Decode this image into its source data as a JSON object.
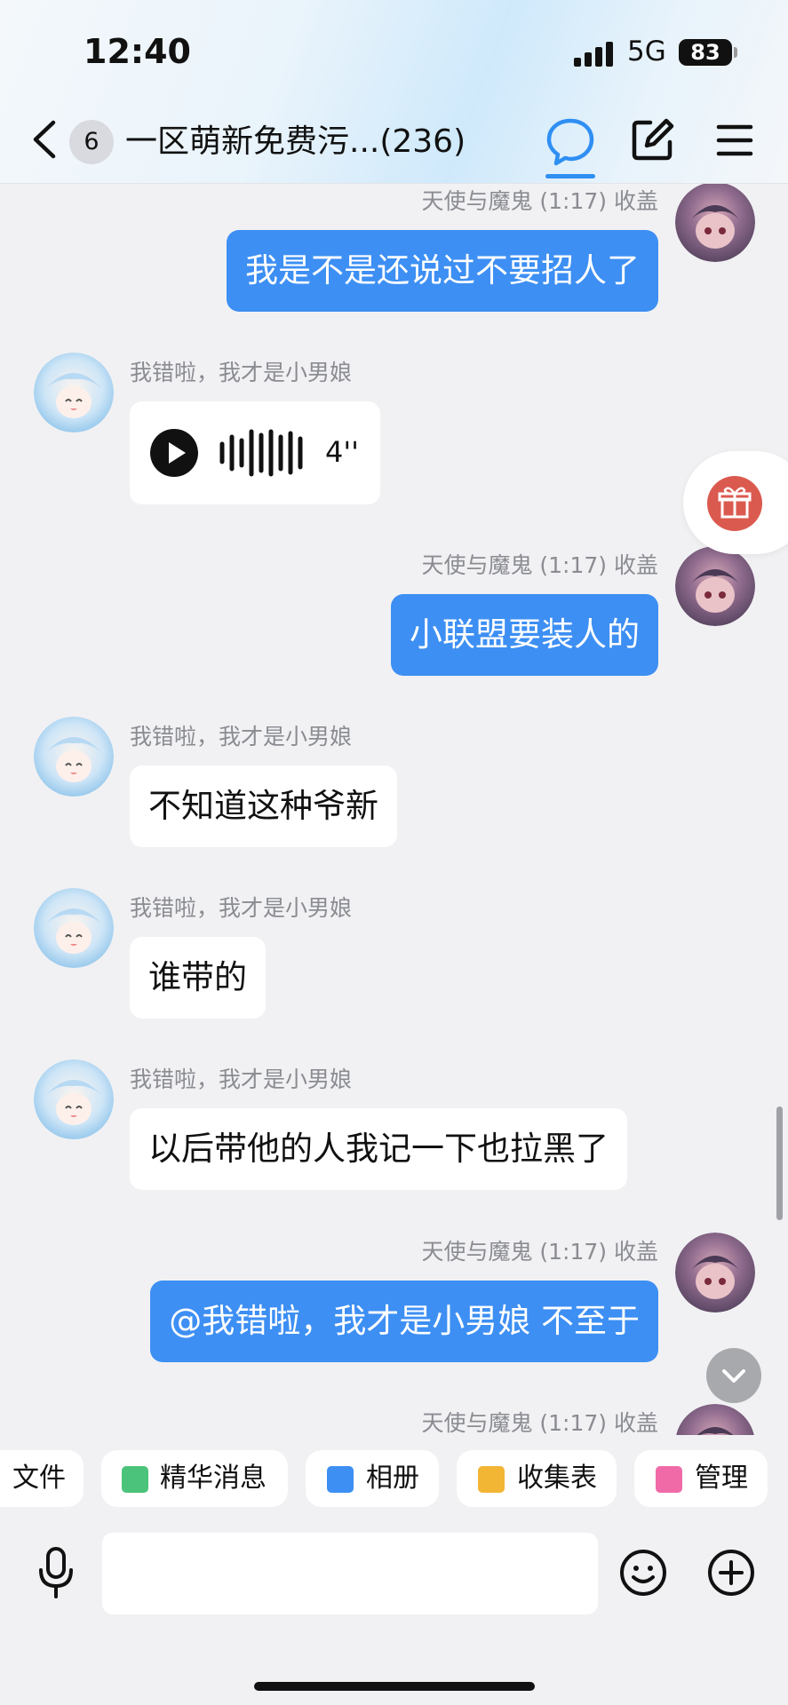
{
  "status": {
    "time": "12:40",
    "network": "5G",
    "battery": "83"
  },
  "header": {
    "unread": "6",
    "title": "一区萌新免费污...(236)"
  },
  "messages": [
    {
      "sender": "天使与魔鬼 (1:17) 收盖",
      "text": "我是不是还说过不要招人了"
    },
    {
      "sender": "我错啦，我才是小男娘",
      "voice_duration": "4''"
    },
    {
      "sender": "天使与魔鬼 (1:17) 收盖",
      "text": "小联盟要装人的"
    },
    {
      "sender": "我错啦，我才是小男娘",
      "text": "不知道这种爷新"
    },
    {
      "sender": "我错啦，我才是小男娘",
      "text": "谁带的"
    },
    {
      "sender": "我错啦，我才是小男娘",
      "text": "以后带他的人我记一下也拉黑了"
    },
    {
      "sender": "天使与魔鬼 (1:17) 收盖",
      "text": "@我错啦，我才是小男娘 不至于"
    },
    {
      "sender": "天使与魔鬼 (1:17) 收盖"
    }
  ],
  "quickbar": [
    {
      "label": "文件",
      "color": "#f2a93b"
    },
    {
      "label": "精华消息",
      "color": "#4cc37a"
    },
    {
      "label": "相册",
      "color": "#3d8ff3"
    },
    {
      "label": "收集表",
      "color": "#f2b534"
    },
    {
      "label": "管理",
      "color": "#f06aa8"
    }
  ],
  "input": {
    "placeholder": ""
  },
  "colors": {
    "accent": "#3d8ff3",
    "gift": "#db5a4f"
  },
  "icons": [
    "back-icon",
    "chat-icon",
    "edit-icon",
    "menu-icon",
    "play-icon",
    "gift-icon",
    "chevron-down-icon",
    "mic-icon",
    "emoji-icon",
    "plus-circle-icon"
  ]
}
